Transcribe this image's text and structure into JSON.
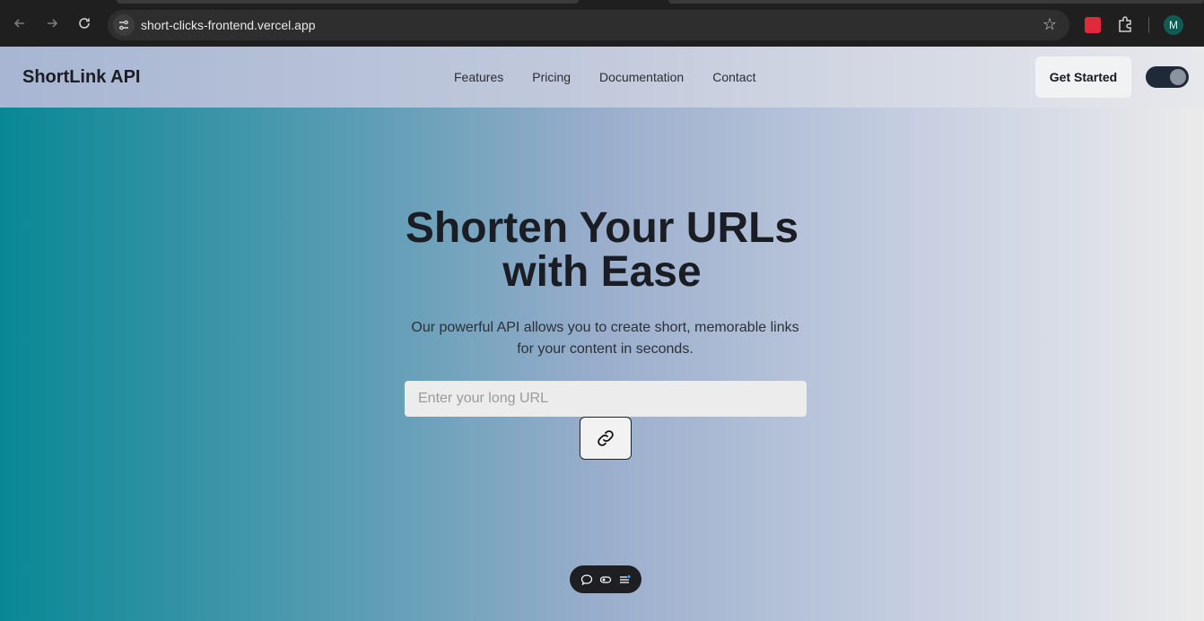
{
  "browser": {
    "url": "short-clicks-frontend.vercel.app",
    "profile_initial": "M"
  },
  "header": {
    "logo": "ShortLink API",
    "nav": [
      "Features",
      "Pricing",
      "Documentation",
      "Contact"
    ],
    "cta_label": "Get Started",
    "theme_toggle": "on"
  },
  "hero": {
    "title_line1": "Shorten Your URLs",
    "title_line2": "with Ease",
    "subtitle_line1": "Our powerful API allows you to create short, memorable links",
    "subtitle_line2": "for your content in seconds.",
    "input_placeholder": "Enter your long URL",
    "submit_icon": "link-icon"
  },
  "floating_toolbar": {
    "icons": [
      "comment-icon",
      "toggle-icon",
      "menu-icon"
    ]
  },
  "colors": {
    "accent_teal": "#088895",
    "text_dark": "#1a1d24",
    "chrome_bg": "#1f1f1f"
  }
}
